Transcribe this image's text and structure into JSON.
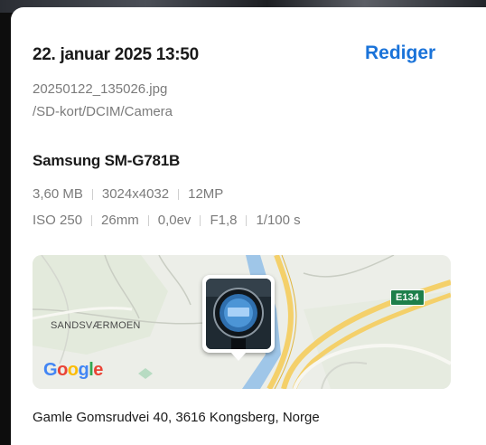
{
  "details": {
    "date_time": "22. januar 2025 13:50",
    "edit_label": "Rediger",
    "filename": "20250122_135026.jpg",
    "path": "/SD-kort/DCIM/Camera"
  },
  "device": {
    "model": "Samsung SM-G781B",
    "file_specs": [
      "3,60 MB",
      "3024x4032",
      "12MP"
    ],
    "camera_specs": [
      "ISO 250",
      "26mm",
      "0,0ev",
      "F1,8",
      "1/100 s"
    ]
  },
  "map": {
    "road_label": "E134",
    "place_label": "SANDSVÆRMOEN",
    "logo_text": "Google",
    "logo_colors": [
      "#4285F4",
      "#EA4335",
      "#FBBC05",
      "#4285F4",
      "#34A853",
      "#EA4335"
    ]
  },
  "location": {
    "address": "Gamle Gomsrudvei 40, 3616 Kongsberg, Norge"
  }
}
